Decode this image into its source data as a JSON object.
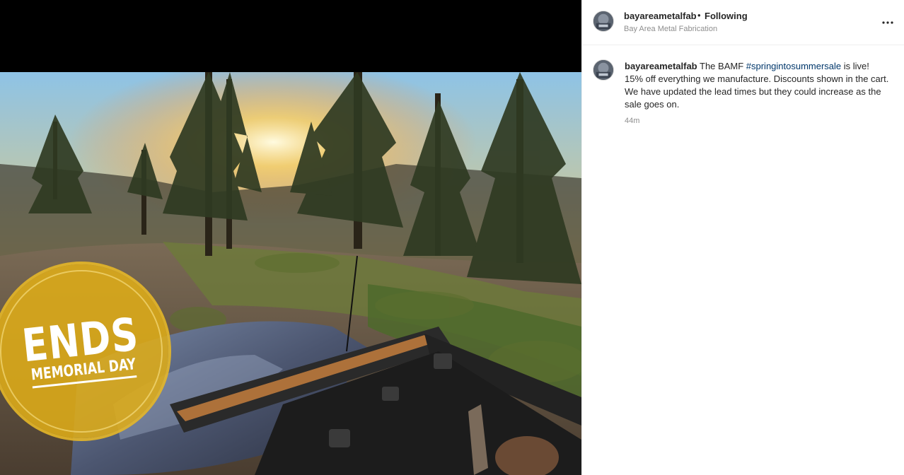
{
  "media": {
    "badge_headline": "ENDS",
    "badge_subline": "MEMORIAL DAY",
    "badge_color": "#deac18"
  },
  "header": {
    "username": "bayareametalfab",
    "separator": "•",
    "follow_status": "Following",
    "subtitle": "Bay Area Metal Fabrication",
    "options_icon": "more-horizontal-icon"
  },
  "caption": {
    "username": "bayareametalfab",
    "text_before_hashtag": "The BAMF ",
    "hashtag": "#springintosummersale",
    "text_after_hashtag": " is live!",
    "line2": "15% off everything we manufacture. Discounts shown in the cart.",
    "line3": "We have updated the lead times but they could increase as the sale goes on.",
    "time": "44m"
  },
  "colors": {
    "hashtag_link": "#00376b",
    "secondary_text": "#8e8e8e",
    "divider": "#efefef"
  }
}
